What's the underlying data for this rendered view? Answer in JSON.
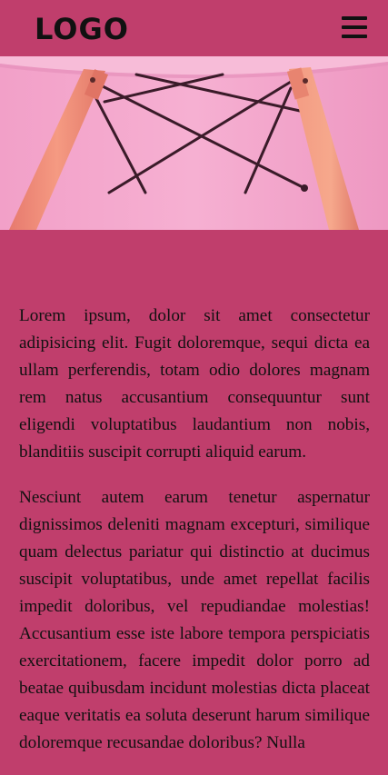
{
  "header": {
    "logo_text": "LOGO",
    "menu_icon": "hamburger-menu-icon"
  },
  "hero": {
    "image_subject": "pink chair legs against pink wall",
    "colors": {
      "wall": "#f4a6cc",
      "seat": "#f7b8d6",
      "legs": "#f28f7d",
      "wire": "#3b1d2a"
    }
  },
  "content": {
    "paragraphs": [
      "Lorem ipsum, dolor sit amet consectetur adipisicing elit. Fugit doloremque, sequi dicta ea ullam perferendis, totam odio dolores magnam rem natus accusantium consequuntur sunt eligendi voluptatibus laudantium non nobis, blanditiis suscipit corrupti aliquid earum.",
      "Nesciunt autem earum tenetur aspernatur dignissimos deleniti magnam excepturi, similique quam delectus pariatur qui distinctio at ducimus suscipit voluptatibus, unde amet repellat facilis impedit doloribus, vel repudiandae molestias! Accusantium esse iste labore tempora perspiciatis exercitationem, facere impedit dolor porro ad beatae quibusdam incidunt molestias dicta placeat eaque veritatis ea soluta deserunt harum similique doloremque recusandae doloribus? Nulla"
    ]
  },
  "colors": {
    "background": "#c03e6c",
    "text": "#111111"
  }
}
